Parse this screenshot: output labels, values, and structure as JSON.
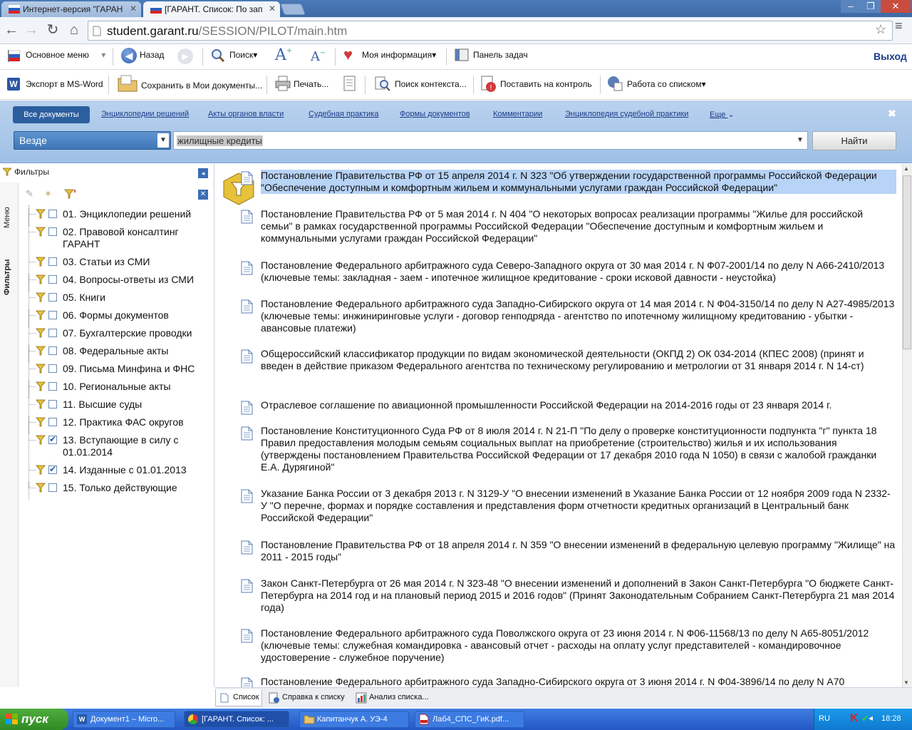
{
  "browser": {
    "tabs": [
      {
        "title": "Интернет-версия \"ГАРАН"
      },
      {
        "title": "[ГАРАНТ. Список: По зап"
      }
    ],
    "url_host": "student.garant.ru",
    "url_path": "/SESSION/PILOT/main.htm"
  },
  "toolbar1": {
    "main_menu": "Основное меню",
    "back": "Назад",
    "search": "Поиск",
    "my_info": "Моя информация",
    "task_panel": "Панель задач",
    "exit": "Выход"
  },
  "toolbar2": {
    "export_word": "Экспорт в MS-Word",
    "save_my_docs": "Сохранить в Мои документы...",
    "print": "Печать...",
    "context_search": "Поиск контекста...",
    "control": "Поставить на контроль",
    "list_work": "Работа со списком"
  },
  "search_panel": {
    "tabs": [
      "Все документы",
      "Энциклопедии решений",
      "Акты органов власти",
      "Судебная практика",
      "Формы документов",
      "Комментарии",
      "Энциклопедия судебной практики",
      "Еще"
    ],
    "where": "Везде",
    "query": "жилищные кредиты",
    "find": "Найти"
  },
  "left_panel": {
    "header": "Фильтры",
    "vtab_menu": "Меню",
    "vtab_filters": "Фильтры",
    "filters": [
      {
        "label": "01. Энциклопедии решений",
        "checked": false
      },
      {
        "label": "02. Правовой консалтинг ГАРАНТ",
        "checked": false
      },
      {
        "label": "03. Статьи из СМИ",
        "checked": false
      },
      {
        "label": "04. Вопросы-ответы из СМИ",
        "checked": false
      },
      {
        "label": "05. Книги",
        "checked": false
      },
      {
        "label": "06. Формы документов",
        "checked": false
      },
      {
        "label": "07. Бухгалтерские проводки",
        "checked": false
      },
      {
        "label": "08. Федеральные акты",
        "checked": false
      },
      {
        "label": "09. Письма Минфина и ФНС",
        "checked": false
      },
      {
        "label": "10. Региональные акты",
        "checked": false
      },
      {
        "label": "11. Высшие суды",
        "checked": false
      },
      {
        "label": "12. Практика ФАС округов",
        "checked": false
      },
      {
        "label": "13. Вступающие в силу с 01.01.2014",
        "checked": true
      },
      {
        "label": "14. Изданные с 01.01.2013",
        "checked": true
      },
      {
        "label": "15. Только действующие",
        "checked": false
      }
    ]
  },
  "documents": [
    "Постановление Правительства РФ от 15 апреля 2014 г. N 323 \"Об утверждении государственной программы Российской Федерации \"Обеспечение доступным и комфортным жильем и коммунальными услугами граждан Российской Федерации\"",
    "Постановление Правительства РФ от 5 мая 2014 г. N 404 \"О некоторых вопросах реализации программы \"Жилье для российской семьи\" в рамках государственной программы Российской Федерации \"Обеспечение доступным и комфортным жильем и коммунальными услугами граждан Российской Федерации\"",
    "Постановление Федерального арбитражного суда Северо-Западного округа от 30 мая 2014 г. N Ф07-2001/14 по делу N А66-2410/2013 (ключевые темы: закладная - заем - ипотечное жилищное кредитование - сроки исковой давности - неустойка)",
    "Постановление Федерального арбитражного суда Западно-Сибирского округа от 14 мая 2014 г. N Ф04-3150/14 по делу N А27-4985/2013 (ключевые темы: инжиниринговые услуги - договор генподряда - агентство по ипотечному жилищному кредитованию - убытки - авансовые платежи)",
    "Общероссийский классификатор продукции по видам экономической деятельности (ОКПД 2) ОК 034-2014 (КПЕС 2008) (принят и введен в действие приказом Федерального агентства по техническому регулированию и метрологии от 31 января 2014 г. N 14-ст)",
    "Отраслевое соглашение по авиационной промышленности Российской Федерации на 2014-2016 годы от 23 января 2014 г.",
    "Постановление Конституционного Суда РФ от 8 июля 2014 г. N 21-П \"По делу о проверке конституционности подпункта \"г\" пункта 18 Правил предоставления молодым семьям социальных выплат на приобретение (строительство) жилья и их использования (утверждены постановлением Правительства Российской Федерации от 17 декабря 2010 года N 1050) в связи с жалобой гражданки Е.А. Дурягиной\"",
    "Указание Банка России от 3 декабря 2013 г. N 3129-У \"О внесении изменений в Указание Банка России от 12 ноября 2009 года N 2332-У \"О перечне, формах и порядке составления и представления форм отчетности кредитных организаций в Центральный банк Российской Федерации\"",
    "Постановление Правительства РФ от 18 апреля 2014 г. N 359 \"О внесении изменений в федеральную целевую программу \"Жилище\" на 2011 - 2015 годы\"",
    "Закон Санкт-Петербурга от 26 мая 2014 г. N 323-48 \"О внесении изменений и дополнений в Закон Санкт-Петербурга \"О бюджете Санкт-Петербурга на 2014 год и на плановый период 2015 и 2016 годов\" (Принят Законодательным Собранием Санкт-Петербурга 21 мая 2014 года)",
    "Постановление Федерального арбитражного суда Поволжского округа от 23 июня 2014 г. N Ф06-11568/13 по делу N А65-8051/2012 (ключевые темы: служебная командировка - авансовый отчет - расходы на оплату услуг представителей - командировочное удостоверение - служебное поручение)",
    "Постановление Федерального арбитражного суда Западно-Сибирского округа от 3 июня 2014 г. N Ф04-3896/14 по делу N А70"
  ],
  "bottom_tabs": [
    "Список",
    "Справка к списку",
    "Анализ списка..."
  ],
  "taskbar": {
    "start": "пуск",
    "tasks": [
      "Документ1 – Micro...",
      "[ГАРАНТ. Список: ...",
      "Капитанчук А. УЭ-4",
      "Лаб4_СПС_ГиК.pdf..."
    ],
    "lang": "RU",
    "time": "18:28"
  }
}
